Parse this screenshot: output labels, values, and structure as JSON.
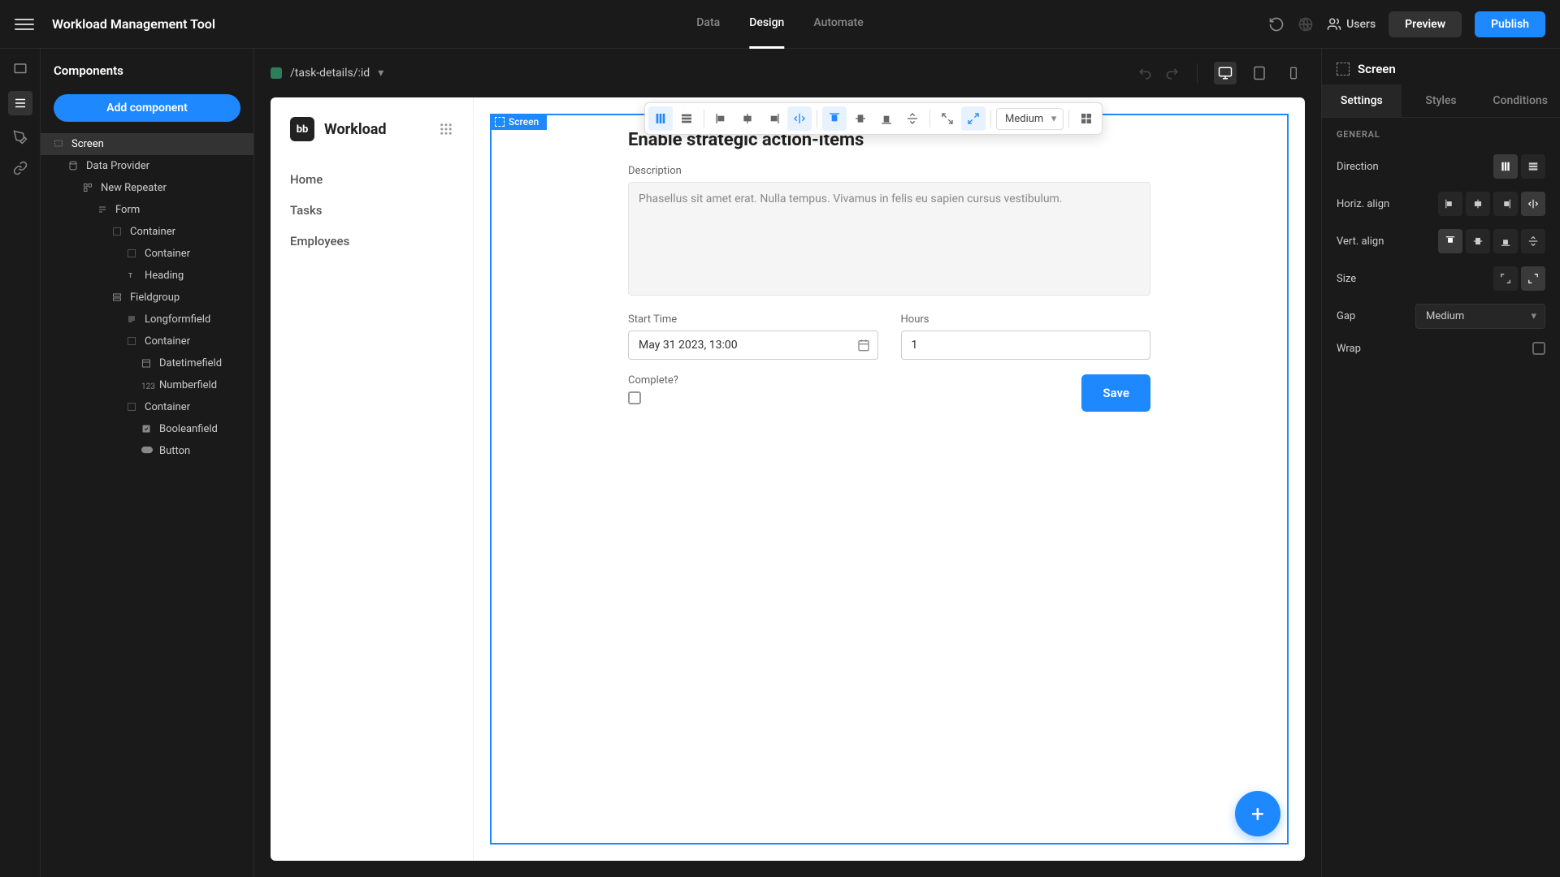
{
  "topbar": {
    "app_title": "Workload Management Tool",
    "tabs": {
      "data": "Data",
      "design": "Design",
      "automate": "Automate"
    },
    "users_label": "Users",
    "preview_label": "Preview",
    "publish_label": "Publish"
  },
  "left_panel": {
    "title": "Components",
    "add_btn": "Add component",
    "tree": [
      {
        "label": "Screen",
        "indent": 0,
        "icon": "screen",
        "selected": true
      },
      {
        "label": "Data Provider",
        "indent": 1,
        "icon": "db"
      },
      {
        "label": "New Repeater",
        "indent": 2,
        "icon": "repeater"
      },
      {
        "label": "Form",
        "indent": 3,
        "icon": "form"
      },
      {
        "label": "Container",
        "indent": 4,
        "icon": "container"
      },
      {
        "label": "Container",
        "indent": 5,
        "icon": "container"
      },
      {
        "label": "Heading",
        "indent": 5,
        "icon": "heading"
      },
      {
        "label": "Fieldgroup",
        "indent": 4,
        "icon": "fieldgroup"
      },
      {
        "label": "Longformfield",
        "indent": 5,
        "icon": "longform"
      },
      {
        "label": "Container",
        "indent": 5,
        "icon": "container"
      },
      {
        "label": "Datetimefield",
        "indent": 6,
        "icon": "datetime"
      },
      {
        "label": "Numberfield",
        "indent": 6,
        "icon": "number"
      },
      {
        "label": "Container",
        "indent": 5,
        "icon": "container"
      },
      {
        "label": "Booleanfield",
        "indent": 6,
        "icon": "boolean"
      },
      {
        "label": "Button",
        "indent": 6,
        "icon": "button"
      }
    ]
  },
  "canvas": {
    "route": "/task-details/:id",
    "selection_badge": "Screen",
    "float_gap_label": "Medium"
  },
  "preview": {
    "brand": "Workload",
    "logo": "bb",
    "nav": {
      "home": "Home",
      "tasks": "Tasks",
      "employees": "Employees"
    },
    "form": {
      "heading": "Enable strategic action-items",
      "desc_label": "Description",
      "desc_value": "Phasellus sit amet erat. Nulla tempus. Vivamus in felis eu sapien cursus vestibulum.",
      "start_label": "Start Time",
      "start_value": "May 31 2023, 13:00",
      "hours_label": "Hours",
      "hours_value": "1",
      "complete_label": "Complete?",
      "save_label": "Save"
    }
  },
  "right_panel": {
    "header": "Screen",
    "tabs": {
      "settings": "Settings",
      "styles": "Styles",
      "conditions": "Conditions"
    },
    "section": "GENERAL",
    "rows": {
      "direction": "Direction",
      "halign": "Horiz. align",
      "valign": "Vert. align",
      "size": "Size",
      "gap": "Gap",
      "gap_value": "Medium",
      "wrap": "Wrap"
    }
  }
}
